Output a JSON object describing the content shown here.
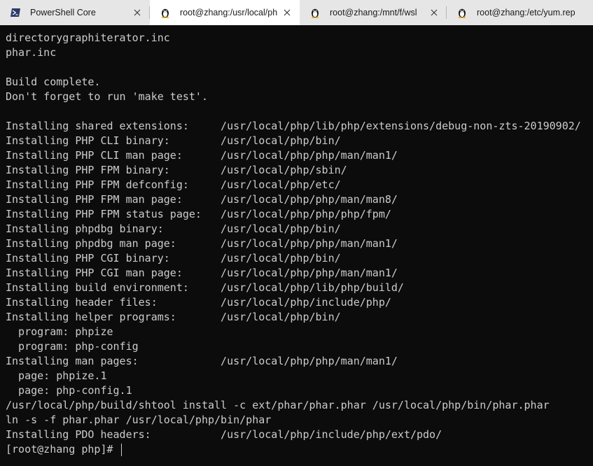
{
  "tabs": [
    {
      "title": "PowerShell Core",
      "icon": "powershell-icon",
      "active": false
    },
    {
      "title": "root@zhang:/usr/local/ph",
      "icon": "linux-tux-icon",
      "active": true
    },
    {
      "title": "root@zhang:/mnt/f/wsl",
      "icon": "linux-tux-icon",
      "active": false
    },
    {
      "title": "root@zhang:/etc/yum.rep",
      "icon": "linux-tux-icon",
      "active": false
    }
  ],
  "terminal": {
    "lines": [
      "directorygraphiterator.inc",
      "phar.inc",
      "",
      "Build complete.",
      "Don't forget to run 'make test'.",
      "",
      "Installing shared extensions:     /usr/local/php/lib/php/extensions/debug-non-zts-20190902/",
      "Installing PHP CLI binary:        /usr/local/php/bin/",
      "Installing PHP CLI man page:      /usr/local/php/php/man/man1/",
      "Installing PHP FPM binary:        /usr/local/php/sbin/",
      "Installing PHP FPM defconfig:     /usr/local/php/etc/",
      "Installing PHP FPM man page:      /usr/local/php/php/man/man8/",
      "Installing PHP FPM status page:   /usr/local/php/php/php/fpm/",
      "Installing phpdbg binary:         /usr/local/php/bin/",
      "Installing phpdbg man page:       /usr/local/php/php/man/man1/",
      "Installing PHP CGI binary:        /usr/local/php/bin/",
      "Installing PHP CGI man page:      /usr/local/php/php/man/man1/",
      "Installing build environment:     /usr/local/php/lib/php/build/",
      "Installing header files:          /usr/local/php/include/php/",
      "Installing helper programs:       /usr/local/php/bin/",
      "  program: phpize",
      "  program: php-config",
      "Installing man pages:             /usr/local/php/php/man/man1/",
      "  page: phpize.1",
      "  page: php-config.1",
      "/usr/local/php/build/shtool install -c ext/phar/phar.phar /usr/local/php/bin/phar.phar",
      "ln -s -f phar.phar /usr/local/php/bin/phar",
      "Installing PDO headers:           /usr/local/php/include/php/ext/pdo/"
    ],
    "prompt": "[root@zhang php]# "
  },
  "colors": {
    "terminal_bg": "#0c0c0c",
    "terminal_fg": "#cccccc",
    "tabbar_bg": "#e6e6e6",
    "active_tab_bg": "#ffffff",
    "powershell_blue": "#2b3a67"
  }
}
